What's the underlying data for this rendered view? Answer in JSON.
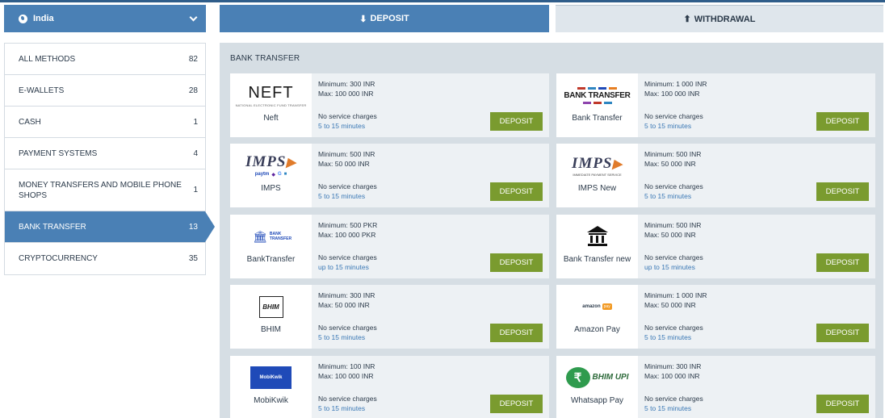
{
  "country": {
    "label": "India"
  },
  "tabs": {
    "deposit": "DEPOSIT",
    "withdrawal": "WITHDRAWAL"
  },
  "methods": [
    {
      "name": "ALL METHODS",
      "count": "82"
    },
    {
      "name": "E-WALLETS",
      "count": "28"
    },
    {
      "name": "CASH",
      "count": "1"
    },
    {
      "name": "PAYMENT SYSTEMS",
      "count": "4"
    },
    {
      "name": "MONEY TRANSFERS AND MOBILE PHONE SHOPS",
      "count": "1"
    },
    {
      "name": "BANK TRANSFER",
      "count": "13"
    },
    {
      "name": "CRYPTOCURRENCY",
      "count": "35"
    }
  ],
  "section_title": "BANK TRANSFER",
  "cards": [
    {
      "name": "Neft",
      "min": "Minimum: 300 INR",
      "max": "Max: 100 000 INR",
      "charges": "No service charges",
      "time": "5 to 15 minutes",
      "button": "DEPOSIT",
      "logo": {
        "big": "NEFT",
        "small": "NATIONAL ELECTRONIC FUND TRANSFER"
      }
    },
    {
      "name": "Bank Transfer",
      "min": "Minimum: 1 000 INR",
      "max": "Max: 100 000 INR",
      "charges": "No service charges",
      "time": "5 to 15 minutes",
      "button": "DEPOSIT",
      "logo": {
        "big": "BANK TRANSFER"
      }
    },
    {
      "name": "IMPS",
      "min": "Minimum: 500 INR",
      "max": "Max: 50 000 INR",
      "charges": "No service charges",
      "time": "5 to 15 minutes",
      "button": "DEPOSIT",
      "logo": {
        "big": "IMPS"
      }
    },
    {
      "name": "IMPS New",
      "min": "Minimum: 500 INR",
      "max": "Max: 50 000 INR",
      "charges": "No service charges",
      "time": "5 to 15 minutes",
      "button": "DEPOSIT",
      "logo": {
        "big": "IMPS",
        "caption": "IMMEDIATE PAYMENT SERVICE"
      }
    },
    {
      "name": "BankTransfer",
      "min": "Minimum: 500 PKR",
      "max": "Max: 100 000 PKR",
      "charges": "No service charges",
      "time": "up to 15 minutes",
      "button": "DEPOSIT",
      "logo": {
        "big": "BANK TRANSFER"
      }
    },
    {
      "name": "Bank Transfer new",
      "min": "Minimum: 500 INR",
      "max": "Max: 50 000 INR",
      "charges": "No service charges",
      "time": "up to 15 minutes",
      "button": "DEPOSIT"
    },
    {
      "name": "BHIM",
      "min": "Minimum: 300 INR",
      "max": "Max: 50 000 INR",
      "charges": "No service charges",
      "time": "5 to 15 minutes",
      "button": "DEPOSIT",
      "logo": {
        "big": "BHIM"
      }
    },
    {
      "name": "Amazon Pay",
      "min": "Minimum: 1 000 INR",
      "max": "Max: 50 000 INR",
      "charges": "No service charges",
      "time": "5 to 15 minutes",
      "button": "DEPOSIT",
      "logo": {
        "big": "amazon",
        "pay": "pay"
      }
    },
    {
      "name": "MobiKwik",
      "min": "Minimum: 100 INR",
      "max": "Max: 100 000 INR",
      "charges": "No service charges",
      "time": "5 to 15 minutes",
      "button": "DEPOSIT",
      "logo": {
        "big": "MobiKwik"
      }
    },
    {
      "name": "Whatsapp Pay",
      "min": "Minimum: 300 INR",
      "max": "Max: 100 000 INR",
      "charges": "No service charges",
      "time": "5 to 15 minutes",
      "button": "DEPOSIT",
      "logo": {
        "big": "BHIM UPI"
      }
    }
  ],
  "colors": {
    "primary": "#4a80b5",
    "button": "#7a9b2f",
    "panel": "#d6dee4",
    "time": "#3a78b5"
  }
}
